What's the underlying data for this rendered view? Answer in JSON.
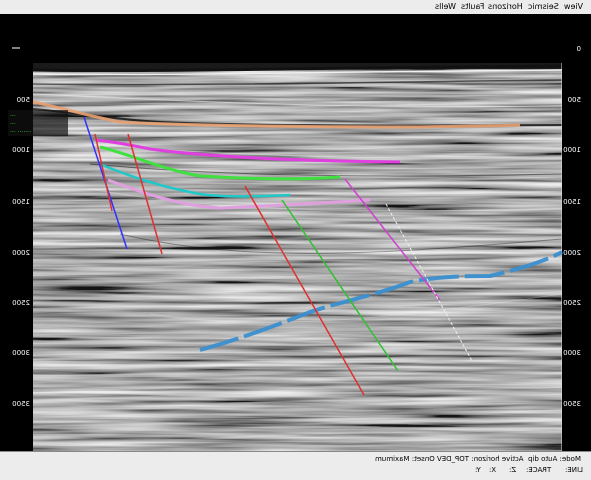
{
  "menubar": {
    "items": [
      "View",
      "Seismic",
      "Horizons",
      "Faults",
      "Wells"
    ]
  },
  "axes": {
    "left_ticks": [
      "500",
      "1000",
      "1500",
      "2000",
      "2500",
      "3000",
      "3500"
    ],
    "right_ticks": [
      "0",
      "500",
      "1000",
      "1500",
      "2000",
      "2500",
      "3000",
      "3500"
    ]
  },
  "overlay_label": {
    "line1": "···",
    "line2": "···",
    "line3": "··· ·······"
  },
  "status": {
    "row1": {
      "mode": "Mode: Auto dip",
      "active": "Active horizon: TOP_DEV  Onset: Maximum"
    },
    "row2": {
      "line": "LINE:",
      "trace": "TRACE:",
      "x": "X:",
      "y": "Y:",
      "z": "Z:"
    }
  },
  "colors": {
    "horizon_orange": "#e8a070",
    "horizon_magenta": "#e040e0",
    "horizon_green": "#40e040",
    "horizon_cyan": "#20c8c8",
    "horizon_pink": "#e0a0e0",
    "horizon_blue": "#3a8fd0",
    "fault_blue": "#3030ff",
    "fault_red": "#e03030",
    "fault_green": "#30c030",
    "fault_magenta": "#d040d0",
    "fault_white": "#f0f0f0"
  }
}
